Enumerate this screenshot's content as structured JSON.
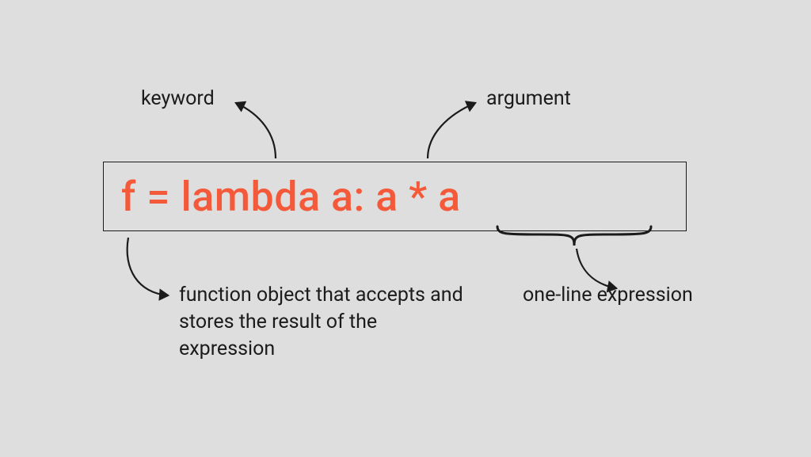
{
  "code": "f = lambda a: a * a",
  "labels": {
    "keyword": "keyword",
    "argument": "argument",
    "funcobj": "function object that accepts and stores the result of the expression",
    "oneline": "one-line expression"
  }
}
